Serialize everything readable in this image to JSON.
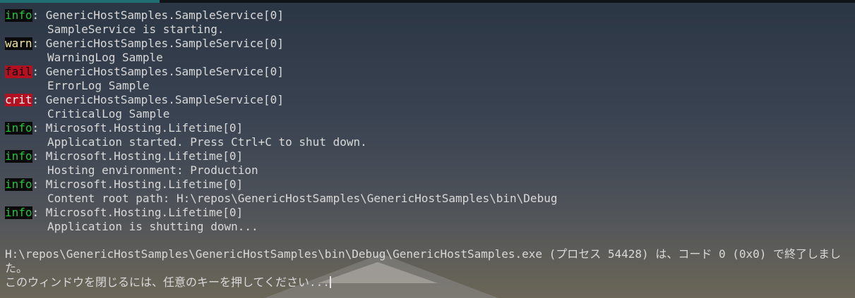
{
  "log_entries": [
    {
      "level": "info",
      "category": ": GenericHostSamples.SampleService[0]",
      "message": "SampleService is starting."
    },
    {
      "level": "warn",
      "category": ": GenericHostSamples.SampleService[0]",
      "message": "WarningLog Sample"
    },
    {
      "level": "fail",
      "category": ": GenericHostSamples.SampleService[0]",
      "message": "ErrorLog Sample"
    },
    {
      "level": "crit",
      "category": ": GenericHostSamples.SampleService[0]",
      "message": "CriticalLog Sample"
    },
    {
      "level": "info",
      "category": ": Microsoft.Hosting.Lifetime[0]",
      "message": "Application started. Press Ctrl+C to shut down."
    },
    {
      "level": "info",
      "category": ": Microsoft.Hosting.Lifetime[0]",
      "message": "Hosting environment: Production"
    },
    {
      "level": "info",
      "category": ": Microsoft.Hosting.Lifetime[0]",
      "message": "Content root path: H:\\repos\\GenericHostSamples\\GenericHostSamples\\bin\\Debug"
    },
    {
      "level": "info",
      "category": ": Microsoft.Hosting.Lifetime[0]",
      "message": "Application is shutting down..."
    }
  ],
  "exit_message": "H:\\repos\\GenericHostSamples\\GenericHostSamples\\bin\\Debug\\GenericHostSamples.exe (プロセス 54428) は、コード 0 (0x0) で終了しました。",
  "close_prompt": "このウィンドウを閉じるには、任意のキーを押してください...",
  "colors": {
    "info": "#22c53a",
    "warn": "#f2e4a0",
    "fail_bg": "#b31021",
    "crit_bg": "#b31021",
    "text": "#d9d9d9"
  }
}
